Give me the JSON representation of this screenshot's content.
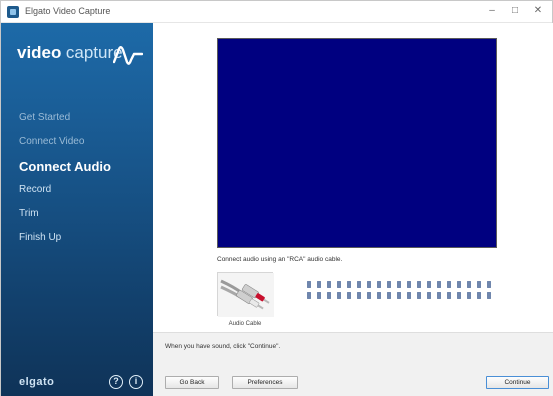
{
  "window": {
    "title": "Elgato Video Capture"
  },
  "titlebar_buttons": {
    "minimize": "–",
    "maximize": "□",
    "close": "✕"
  },
  "sidebar": {
    "logo": {
      "bold": "video",
      "light": "capture"
    },
    "steps": [
      {
        "label": "Get Started",
        "state": "done"
      },
      {
        "label": "Connect Video",
        "state": "done"
      },
      {
        "label": "Connect Audio",
        "state": "active"
      },
      {
        "label": "Record",
        "state": "todo"
      },
      {
        "label": "Trim",
        "state": "todo"
      },
      {
        "label": "Finish Up",
        "state": "todo"
      }
    ],
    "brand": "elgato",
    "help_glyph": "?",
    "info_glyph": "i"
  },
  "main": {
    "preview_color": "#000080",
    "instruction": "Connect audio using an \"RCA\" audio cable.",
    "cable_label": "Audio Cable",
    "meters": {
      "rows": 2,
      "segments_per_row": 19,
      "color": "#6f86ad"
    }
  },
  "footer": {
    "message": "When you have sound, click \"Continue\".",
    "back_label": "Go Back",
    "prefs_label": "Preferences",
    "continue_label": "Continue"
  }
}
